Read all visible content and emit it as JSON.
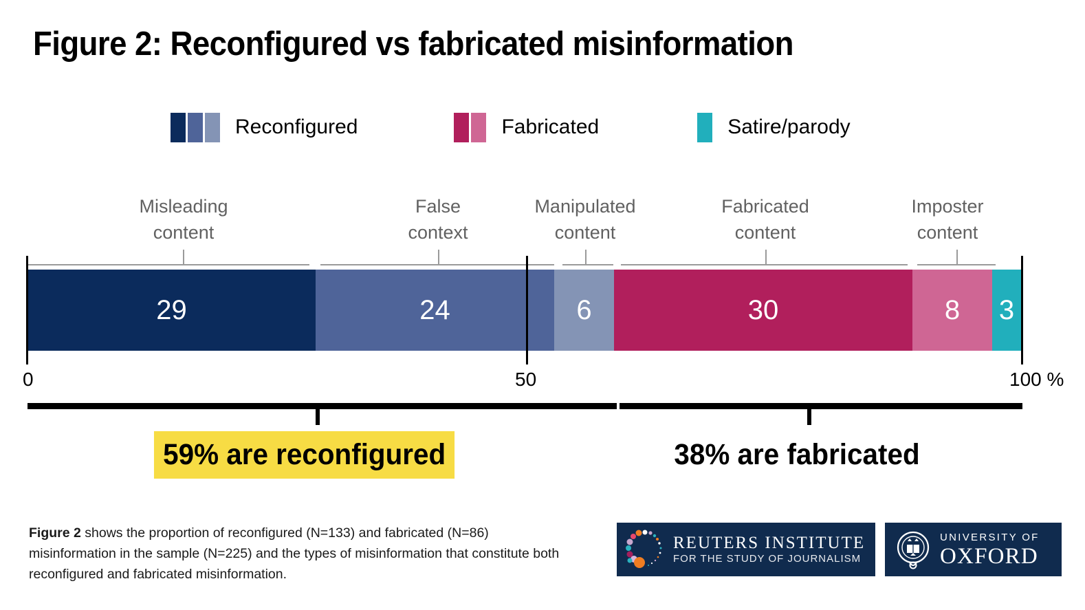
{
  "title": "Figure 2: Reconfigured vs fabricated misinformation",
  "legend": [
    {
      "label": "Reconfigured",
      "colors": [
        "#0B2B5C",
        "#4F6499",
        "#8494B5"
      ]
    },
    {
      "label": "Fabricated",
      "colors": [
        "#B11F5C",
        "#CF6694"
      ]
    },
    {
      "label": "Satire/parody",
      "colors": [
        "#21AFBC"
      ]
    }
  ],
  "axis": {
    "left_label": "0",
    "mid_label": "50",
    "right_label": "100 %"
  },
  "summary": [
    {
      "text": "59% are reconfigured",
      "highlighted": true
    },
    {
      "text": "38% are fabricated",
      "highlighted": false
    }
  ],
  "footnote": {
    "bold": "Figure 2",
    "rest": " shows the proportion of reconfigured (N=133) and fabricated (N=86) misinformation in the sample (N=225) and the types of misinformation that constitute both reconfigured and fabricated misinformation."
  },
  "logos": {
    "reuters": {
      "line1": "REUTERS INSTITUTE",
      "line2": "FOR THE STUDY OF JOURNALISM"
    },
    "oxford": {
      "line1": "UNIVERSITY OF",
      "line2": "OXFORD"
    }
  },
  "chart_data": {
    "type": "bar",
    "orientation": "horizontal-stacked",
    "title": "Figure 2: Reconfigured vs fabricated misinformation",
    "xlabel": "",
    "ylabel": "",
    "xlim": [
      0,
      100
    ],
    "xticks": [
      0,
      50,
      100
    ],
    "xticklabels": [
      "0",
      "50",
      "100 %"
    ],
    "unit": "%",
    "grid": false,
    "legend_position": "top",
    "categories": [
      "Misleading content",
      "False context",
      "Manipulated content",
      "Fabricated content",
      "Imposter content",
      "Satire/parody"
    ],
    "values": [
      29,
      24,
      6,
      30,
      8,
      3
    ],
    "colors": [
      "#0B2B5C",
      "#4F6499",
      "#8494B5",
      "#B11F5C",
      "#CF6694",
      "#21AFBC"
    ],
    "groups": [
      {
        "name": "Reconfigured",
        "total": 59,
        "label": "59% are reconfigured",
        "members": [
          "Misleading content",
          "False context",
          "Manipulated content"
        ]
      },
      {
        "name": "Fabricated",
        "total": 38,
        "label": "38% are fabricated",
        "members": [
          "Fabricated content",
          "Imposter content"
        ]
      },
      {
        "name": "Satire/parody",
        "total": 3,
        "label": "",
        "members": [
          "Satire/parody"
        ]
      }
    ],
    "annotations": [
      "59% are reconfigured",
      "38% are fabricated"
    ],
    "labels_shown": [
      "29",
      "24",
      "6",
      "30",
      "8",
      "3"
    ],
    "bar_label_texts": {
      "seg0": "29",
      "seg1": "24",
      "seg2": "6",
      "seg3": "30",
      "seg4": "8",
      "seg5": "3"
    },
    "category_labels": [
      {
        "line1": "Misleading",
        "line2": "content"
      },
      {
        "line1": "False",
        "line2": "context"
      },
      {
        "line1": "Manipulated",
        "line2": "content"
      },
      {
        "line1": "Fabricated",
        "line2": "content"
      },
      {
        "line1": "Imposter",
        "line2": "content"
      }
    ]
  }
}
